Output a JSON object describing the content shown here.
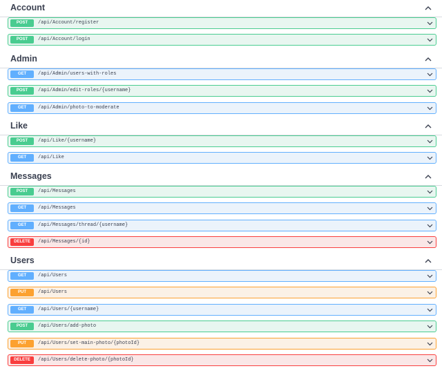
{
  "sections": [
    {
      "name": "Account",
      "operations": [
        {
          "method": "POST",
          "path": "/api/Account/register"
        },
        {
          "method": "POST",
          "path": "/api/Account/login"
        }
      ]
    },
    {
      "name": "Admin",
      "operations": [
        {
          "method": "GET",
          "path": "/api/Admin/users-with-roles"
        },
        {
          "method": "POST",
          "path": "/api/Admin/edit-roles/{username}"
        },
        {
          "method": "GET",
          "path": "/api/Admin/photo-to-moderate"
        }
      ]
    },
    {
      "name": "Like",
      "operations": [
        {
          "method": "POST",
          "path": "/api/Like/{username}"
        },
        {
          "method": "GET",
          "path": "/api/Like"
        }
      ]
    },
    {
      "name": "Messages",
      "operations": [
        {
          "method": "POST",
          "path": "/api/Messages"
        },
        {
          "method": "GET",
          "path": "/api/Messages"
        },
        {
          "method": "GET",
          "path": "/api/Messages/thread/{username}"
        },
        {
          "method": "DELETE",
          "path": "/api/Messages/{id}"
        }
      ]
    },
    {
      "name": "Users",
      "operations": [
        {
          "method": "GET",
          "path": "/api/Users"
        },
        {
          "method": "PUT",
          "path": "/api/Users"
        },
        {
          "method": "GET",
          "path": "/api/Users/{username}"
        },
        {
          "method": "POST",
          "path": "/api/Users/add-photo"
        },
        {
          "method": "PUT",
          "path": "/api/Users/set-main-photo/{photoId}"
        },
        {
          "method": "DELETE",
          "path": "/api/Users/delete-photo/{photoId}"
        }
      ]
    }
  ],
  "icons": {
    "section_toggle": "chevron-up-icon",
    "operation_toggle": "chevron-down-icon"
  },
  "colors": {
    "get": "#61affe",
    "post": "#49cc90",
    "put": "#fca130",
    "delete": "#f93e3e",
    "text": "#3b4151"
  }
}
